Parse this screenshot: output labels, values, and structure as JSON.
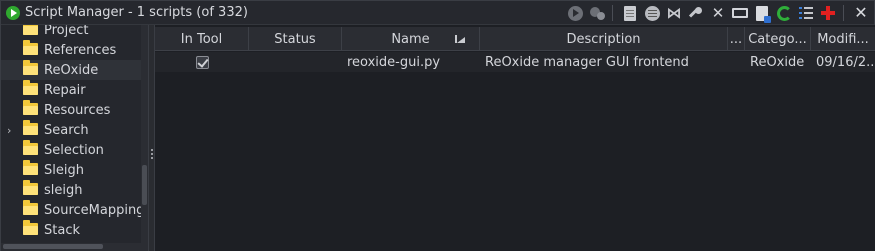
{
  "window": {
    "title": "Script Manager - 1 scripts  (of 332)"
  },
  "toolbar": {
    "buttons": [
      {
        "name": "run-script",
        "icon": "run-icon"
      },
      {
        "name": "run-last-script",
        "icon": "run-again-icon"
      },
      {
        "name": "edit-script",
        "icon": "edit-page-icon"
      },
      {
        "name": "edit-script-eclipse",
        "icon": "edit-circle-icon"
      },
      {
        "name": "edit-vscode",
        "icon": "vscode-icon"
      },
      {
        "name": "assign-key-binding",
        "icon": "key-icon"
      },
      {
        "name": "delete-script",
        "icon": "delete-x-icon"
      },
      {
        "name": "rename-script",
        "icon": "rename-icon"
      },
      {
        "name": "create-new-script",
        "icon": "new-script-icon"
      },
      {
        "name": "refresh-scripts",
        "icon": "refresh-icon"
      },
      {
        "name": "script-directories",
        "icon": "list-icon"
      },
      {
        "name": "help",
        "icon": "red-cross-icon"
      }
    ],
    "close_glyph": "✕"
  },
  "tree": {
    "items": [
      {
        "label": "Project",
        "expandable": false,
        "selected": false
      },
      {
        "label": "References",
        "expandable": false,
        "selected": false
      },
      {
        "label": "ReOxide",
        "expandable": false,
        "selected": true
      },
      {
        "label": "Repair",
        "expandable": false,
        "selected": false
      },
      {
        "label": "Resources",
        "expandable": false,
        "selected": false
      },
      {
        "label": "Search",
        "expandable": true,
        "selected": false
      },
      {
        "label": "Selection",
        "expandable": false,
        "selected": false
      },
      {
        "label": "Sleigh",
        "expandable": false,
        "selected": false
      },
      {
        "label": "sleigh",
        "expandable": false,
        "selected": false
      },
      {
        "label": "SourceMapping",
        "expandable": false,
        "selected": false
      },
      {
        "label": "Stack",
        "expandable": false,
        "selected": false
      }
    ],
    "caret_glyph": "›"
  },
  "table": {
    "columns": [
      {
        "label": "In Tool"
      },
      {
        "label": "Status"
      },
      {
        "label": "Name"
      },
      {
        "label": "Description"
      },
      {
        "label": "..."
      },
      {
        "label": "Catego..."
      },
      {
        "label": "Modifi..."
      }
    ],
    "rows": [
      {
        "in_tool": true,
        "status": "",
        "name": "reoxide-gui.py",
        "description": "ReOxide manager GUI frontend",
        "extra": "",
        "category": "ReOxide",
        "modified": "09/16/2..."
      }
    ]
  },
  "colors": {
    "background": "#1e2026",
    "folder": "#f3c83a",
    "run": "#2fa82f",
    "refresh": "#2fae3a",
    "help": "#e02020"
  }
}
